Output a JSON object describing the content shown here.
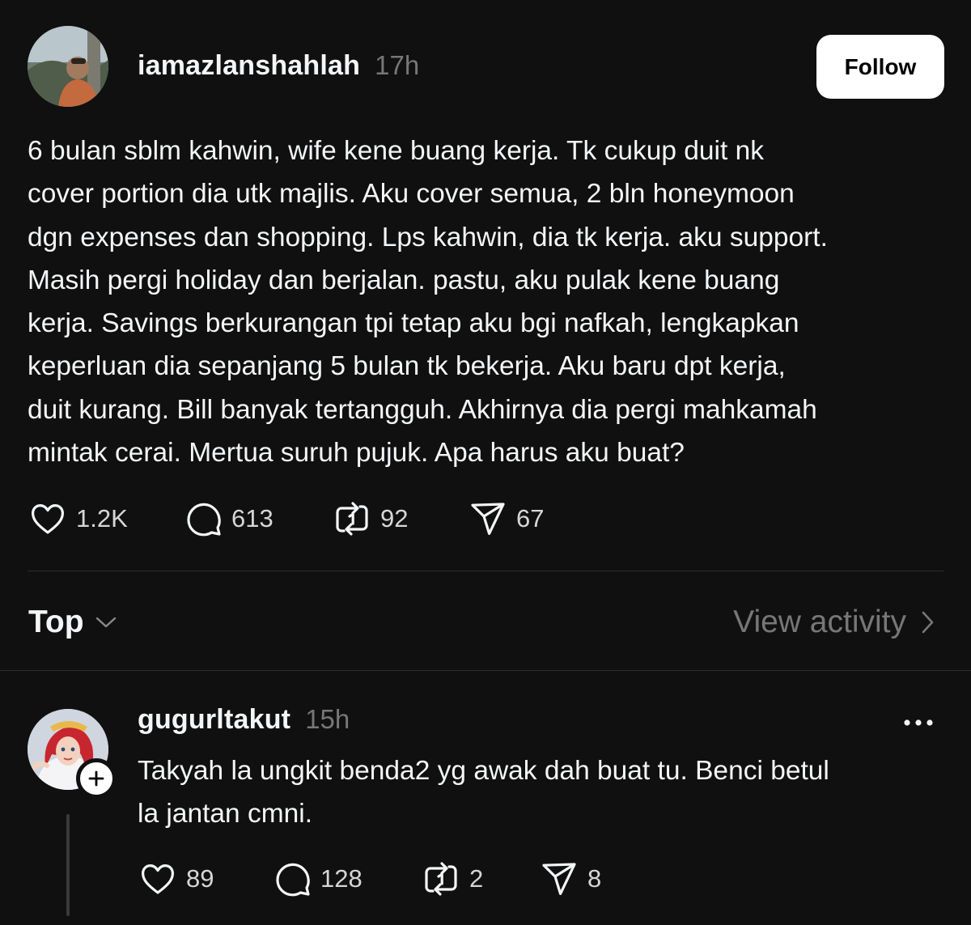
{
  "post": {
    "username": "iamazlanshahlah",
    "timestamp": "17h",
    "follow_label": "Follow",
    "text": "6 bulan sblm kahwin, wife kene buang kerja. Tk cukup duit nk\ncover portion dia utk majlis. Aku cover semua, 2 bln honeymoon\ndgn expenses dan shopping. Lps kahwin, dia tk kerja. aku support.\nMasih pergi holiday dan berjalan. pastu, aku pulak kene buang\nkerja. Savings berkurangan tpi tetap aku bgi nafkah, lengkapkan\nkeperluan dia sepanjang 5 bulan tk bekerja. Aku baru dpt kerja,\nduit kurang. Bill banyak tertangguh. Akhirnya dia pergi mahkamah\nmintak cerai. Mertua suruh pujuk. Apa harus aku buat?",
    "actions": {
      "likes": "1.2K",
      "comments": "613",
      "reposts": "92",
      "shares": "67"
    }
  },
  "sort": {
    "label": "Top",
    "view_activity_label": "View activity"
  },
  "reply": {
    "username": "gugurltakut",
    "timestamp": "15h",
    "text": "Takyah la ungkit benda2 yg awak dah buat tu. Benci betul\nla jantan cmni.",
    "actions": {
      "likes": "89",
      "comments": "128",
      "reposts": "2",
      "shares": "8"
    }
  },
  "icons": {
    "like": "heart-icon",
    "comment": "comment-bubble-icon",
    "repost": "repost-icon",
    "share": "send-icon",
    "sort": "chevron-down-icon",
    "view_activity": "chevron-right-icon",
    "more": "more-dots-icon",
    "follow_badge": "plus-icon"
  },
  "colors": {
    "background": "#101010",
    "text_primary": "#f3f5f7",
    "text_secondary": "#777777",
    "follow_button_bg": "#ffffff"
  }
}
